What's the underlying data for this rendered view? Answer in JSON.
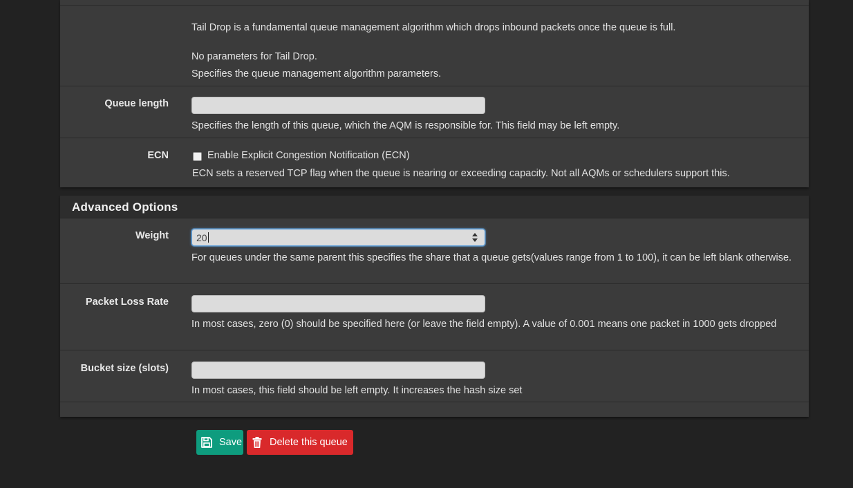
{
  "queue_panel": {
    "aqm_description": "Tail Drop is a fundamental queue management algorithm which drops inbound packets once the queue is full.",
    "no_params": "No parameters for Tail Drop.",
    "params_help": "Specifies the queue management algorithm parameters.",
    "queue_length": {
      "label": "Queue length",
      "value": "",
      "help": "Specifies the length of this queue, which the AQM is responsible for. This field may be left empty."
    },
    "ecn": {
      "label": "ECN",
      "checkbox_label": "Enable Explicit Congestion Notification (ECN)",
      "checked": false,
      "help": "ECN sets a reserved TCP flag when the queue is nearing or exceeding capacity. Not all AQMs or schedulers support this."
    }
  },
  "advanced": {
    "title": "Advanced Options",
    "weight": {
      "label": "Weight",
      "value": "20",
      "help": "For queues under the same parent this specifies the share that a queue gets(values range from 1 to 100), it can be left blank otherwise."
    },
    "packet_loss_rate": {
      "label": "Packet Loss Rate",
      "value": "",
      "help": "In most cases, zero (0) should be specified here (or leave the field empty). A value of 0.001 means one packet in 1000 gets dropped"
    },
    "bucket_size": {
      "label": "Bucket size (slots)",
      "value": "",
      "help": "In most cases, this field should be left empty. It increases the hash size set"
    }
  },
  "actions": {
    "save_label": "Save",
    "delete_label": "Delete this queue",
    "save_color": "#0e9c7e",
    "delete_color": "#d9292b",
    "save_icon": "floppy-disk-icon",
    "delete_icon": "trash-icon"
  }
}
